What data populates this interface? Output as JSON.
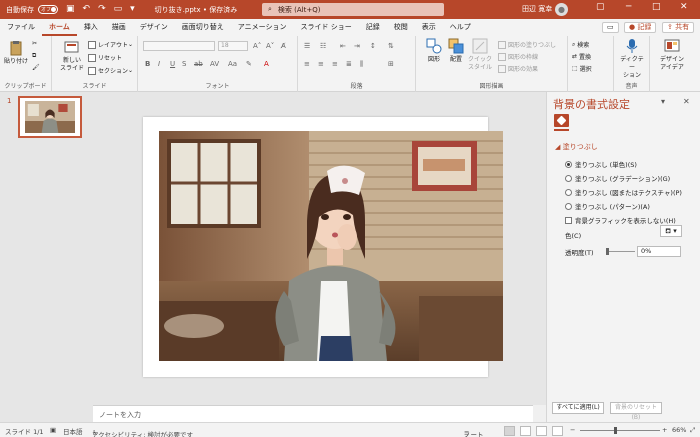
{
  "colors": {
    "accent": "#b7472a",
    "ribbon_bg": "#f3f3f3",
    "workspace_bg": "#e6e6e6"
  },
  "titlebar": {
    "autosave_label": "自動保存",
    "autosave_state": "オフ",
    "filename": "切り抜き.pptx • 保存済み",
    "search_placeholder": "検索 (Alt+Q)",
    "user_name": "田辺 寛幸",
    "avatar_icon": "person-icon"
  },
  "menu": {
    "tabs": [
      "ファイル",
      "ホーム",
      "挿入",
      "描画",
      "デザイン",
      "画面切り替え",
      "アニメーション",
      "スライド ショー",
      "記録",
      "校閲",
      "表示",
      "ヘルプ"
    ],
    "active_tab": "ホーム",
    "record_label": "記録",
    "share_label": "共有"
  },
  "ribbon": {
    "groups": {
      "clipboard": "クリップボード",
      "slides": "スライド",
      "font": "フォント",
      "paragraph": "段落",
      "drawing": "図形描画",
      "voice": "音声"
    },
    "paste_label": "貼り付け",
    "new_slide_label": "新しい\nスライド",
    "layout_label": "レイアウト",
    "reset_label": "リセット",
    "section_label": "セクション",
    "shapes_label": "図形",
    "arrange_label": "配置",
    "quick_styles_label": "クイック\nスタイル",
    "shape_fill_label": "図形の塗りつぶし",
    "shape_outline_label": "図形の枠線",
    "shape_effects_label": "図形の効果",
    "find_label": "検索",
    "replace_label": "置換",
    "select_label": "選択",
    "dictate_label": "ディクテー\nション",
    "designer_label": "デザイン\nアイデア",
    "font_size": "18"
  },
  "thumbnails": {
    "slide_number": "1"
  },
  "editor": {
    "notes_placeholder": "ノートを入力"
  },
  "format_pane": {
    "title": "背景の書式設定",
    "section_fill": "塗りつぶし",
    "options": [
      {
        "label": "塗りつぶし (単色)(S)",
        "selected": true
      },
      {
        "label": "塗りつぶし (グラデーション)(G)",
        "selected": false
      },
      {
        "label": "塗りつぶし (図またはテクスチャ)(P)",
        "selected": false
      },
      {
        "label": "塗りつぶし (パターン)(A)",
        "selected": false
      }
    ],
    "hide_graphics_label": "背景グラフィックを表示しない(H)",
    "color_label": "色(C)",
    "transparency_label": "透明度(T)",
    "transparency_value": "0%",
    "apply_all_label": "すべてに適用(L)",
    "reset_bg_label": "背景のリセット(B)"
  },
  "status": {
    "slide_info": "スライド 1/1",
    "language": "日本語",
    "accessibility": "アクセシビリティ: 検討が必要です",
    "notes_label": "ノート",
    "zoom": "66%"
  }
}
